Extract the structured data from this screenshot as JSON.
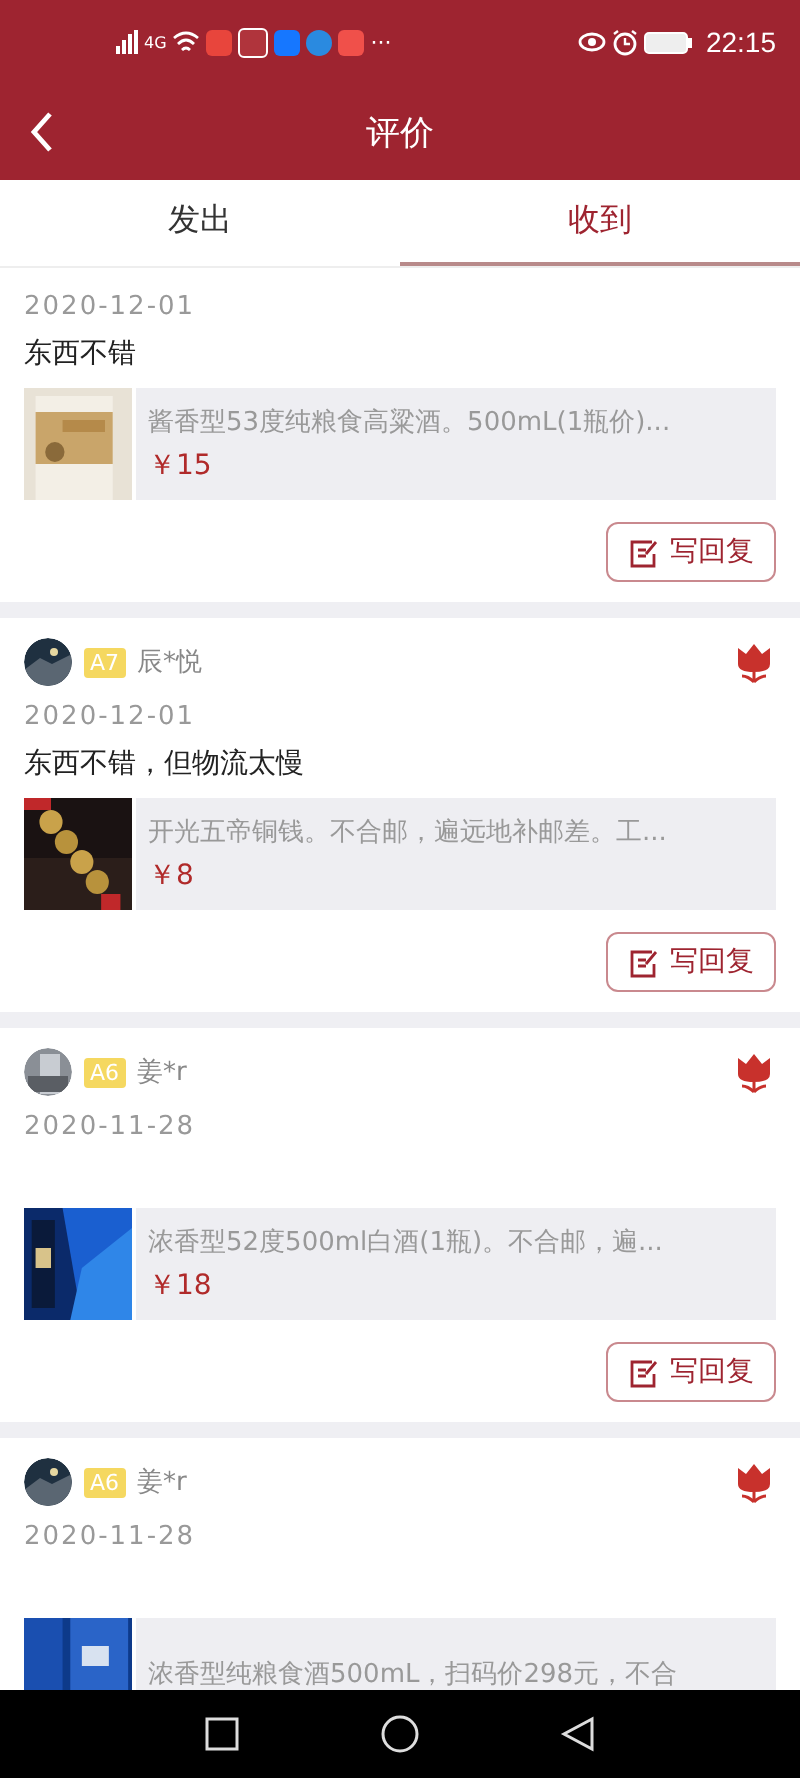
{
  "status_bar": {
    "network": "4G",
    "more": "···",
    "time": "22:15"
  },
  "header": {
    "title": "评价"
  },
  "tabs": [
    {
      "label": "发出",
      "selected": false
    },
    {
      "label": "收到",
      "selected": true
    }
  ],
  "reviews": [
    {
      "date": "2020-12-01",
      "text": "东西不错",
      "product": {
        "name": "酱香型53度纯粮食高粱酒。500mL(1瓶价)...",
        "price": "￥15",
        "kind": "picture"
      },
      "reply": "写回复"
    },
    {
      "user": {
        "level": "A7",
        "name": "辰*悦"
      },
      "date": "2020-12-01",
      "text": "东西不错，但物流太慢",
      "product": {
        "name": "开光五帝铜钱。不合邮，遍远地补邮差。工...",
        "price": "￥8",
        "kind": "picture"
      },
      "reply": "写回复"
    },
    {
      "user": {
        "level": "A6",
        "name": "姜*r"
      },
      "date": "2020-11-28",
      "product": {
        "name": "浓香型52度500ml白酒(1瓶)。不合邮，遍...",
        "price": "￥18",
        "kind": "picture"
      },
      "reply": "写回复"
    },
    {
      "user": {
        "level": "A6",
        "name": "姜*r"
      },
      "date": "2020-11-28",
      "product": {
        "name": "浓香型纯粮食酒500mL，扫码价298元，不合",
        "kind": "picture"
      }
    }
  ]
}
